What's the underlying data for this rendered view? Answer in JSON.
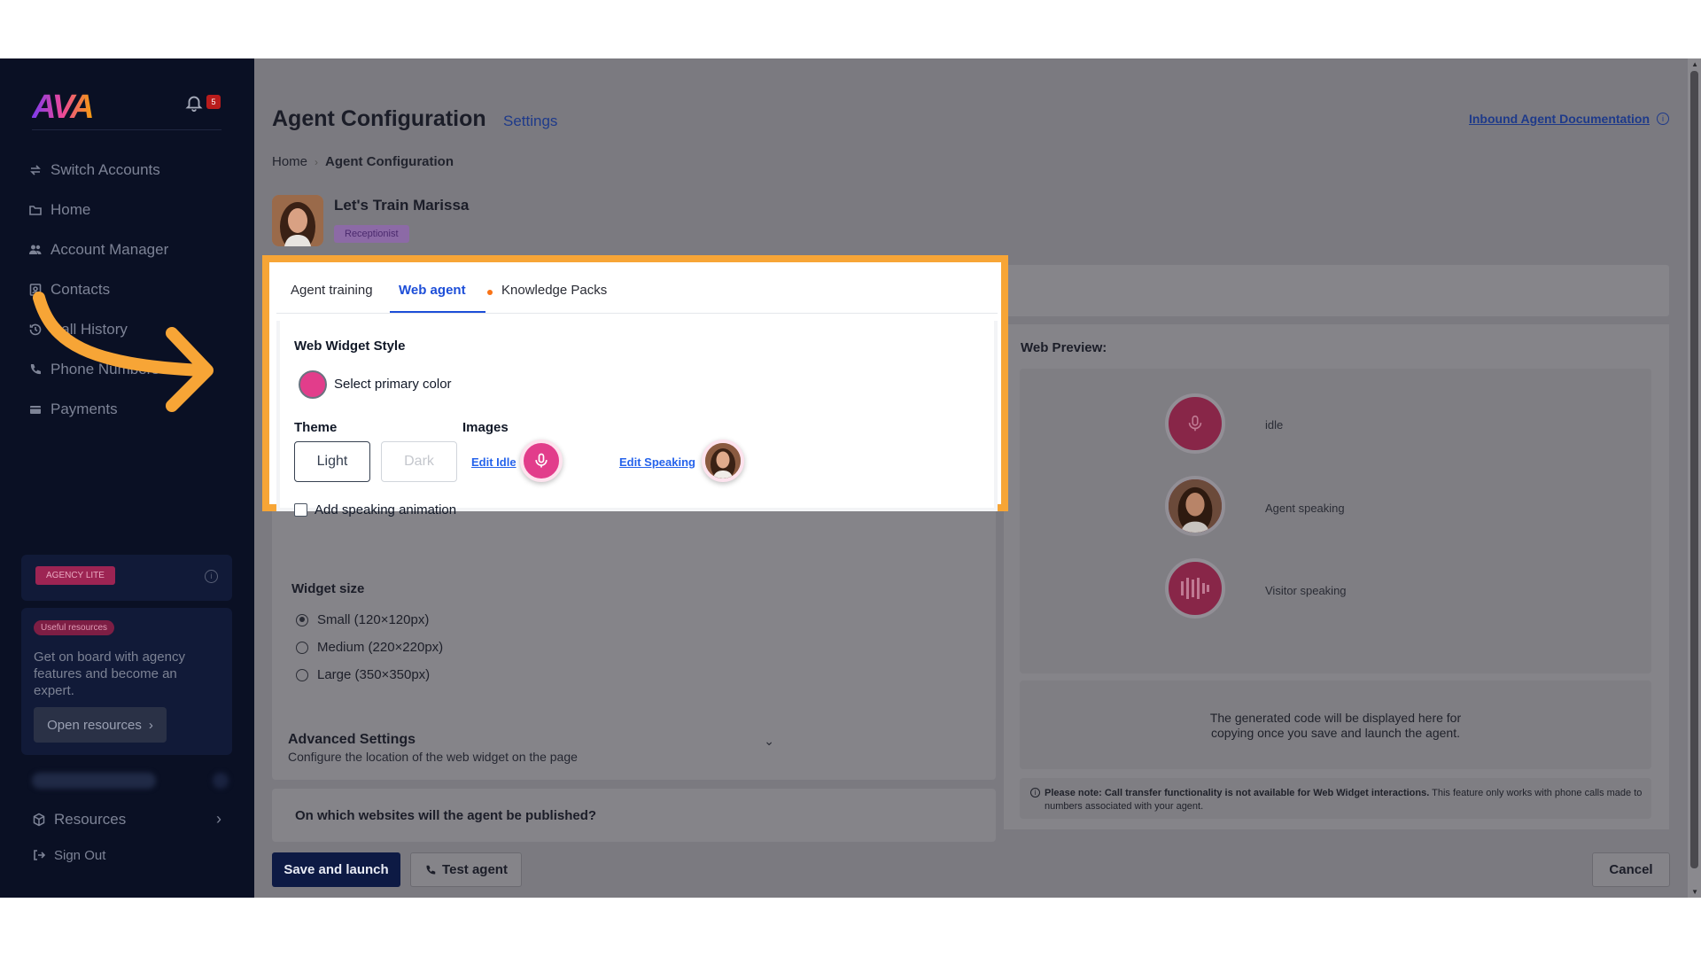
{
  "sidebar": {
    "notifications_count": "5",
    "items": [
      {
        "label": "Switch Accounts",
        "icon": "switch-icon"
      },
      {
        "label": "Home",
        "icon": "folder-icon"
      },
      {
        "label": "Account Manager",
        "icon": "users-icon"
      },
      {
        "label": "Contacts",
        "icon": "contacts-icon"
      },
      {
        "label": "Call History",
        "icon": "history-icon"
      },
      {
        "label": "Phone Numbers",
        "icon": "phone-icon"
      },
      {
        "label": "Payments",
        "icon": "card-icon"
      }
    ],
    "agency_badge": "AGENCY LITE",
    "resources_badge": "Useful resources",
    "resources_text": "Get on board with agency features and become an expert.",
    "resources_button": "Open resources",
    "footer_items": [
      {
        "label": "Resources",
        "icon": "cube-icon"
      },
      {
        "label": "Sign Out",
        "icon": "signout-icon"
      }
    ]
  },
  "header": {
    "title": "Agent Configuration",
    "settings_link": "Settings",
    "doc_link": "Inbound Agent Documentation"
  },
  "breadcrumb": {
    "home": "Home",
    "current": "Agent Configuration"
  },
  "agent": {
    "name": "Let's Train Marissa",
    "role": "Receptionist"
  },
  "tabs": [
    "Agent training",
    "Web agent",
    "Knowledge Packs"
  ],
  "web_widget": {
    "title": "Web Widget Style",
    "primary_color": "#e23d8b",
    "color_label": "Select primary color",
    "theme_title": "Theme",
    "theme_light": "Light",
    "theme_dark": "Dark",
    "images_title": "Images",
    "edit_idle": "Edit Idle",
    "edit_speaking": "Edit Speaking",
    "speaking_animation": "Add speaking animation",
    "speaking_animation_checked": false
  },
  "widget_size": {
    "title": "Widget size",
    "options": [
      "Small (120×120px)",
      "Medium (220×220px)",
      "Large (350×350px)"
    ],
    "selected": "Small (120×120px)"
  },
  "advanced": {
    "title": "Advanced Settings",
    "subtitle": "Configure the location of the web widget on the page"
  },
  "websites_question": "On which websites will the agent be published?",
  "preview": {
    "title": "Web Preview:",
    "states": [
      "idle",
      "Agent speaking",
      "Visitor speaking"
    ],
    "code_text": "The generated code will be displayed here for copying once you save and launch the agent.",
    "note_bold": "Please note: Call transfer functionality is not available for Web Widget interactions.",
    "note_rest": "This feature only works with phone calls made to numbers associated with your agent."
  },
  "footer": {
    "save": "Save and launch",
    "test": "Test agent",
    "cancel": "Cancel"
  },
  "colors": {
    "highlight": "#f7a536",
    "accent_blue": "#1d4ed8",
    "brand_pink": "#e23d8b"
  }
}
